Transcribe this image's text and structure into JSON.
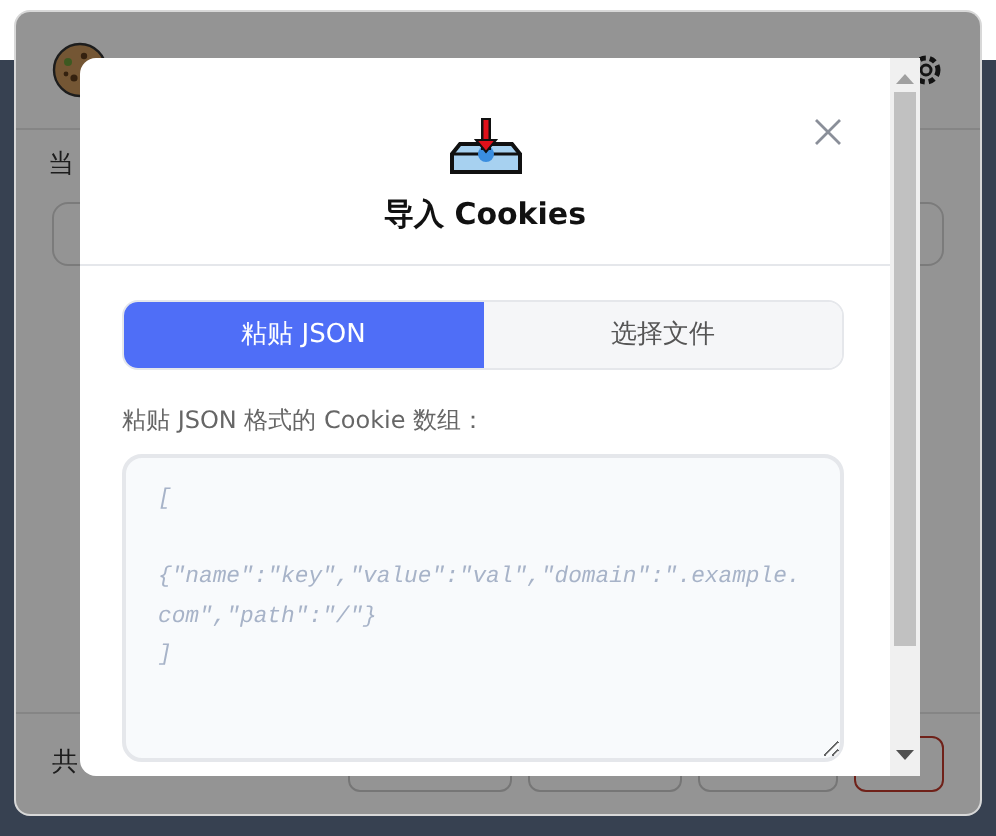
{
  "background": {
    "status_text": "当",
    "count_text": "共",
    "footer_buttons": [
      {
        "kind": "outline"
      },
      {
        "kind": "outline"
      },
      {
        "kind": "outline"
      },
      {
        "kind": "danger"
      }
    ]
  },
  "modal": {
    "title": "导入 Cookies",
    "tabs": [
      {
        "label": "粘贴 JSON",
        "selected": true
      },
      {
        "label": "选择文件",
        "selected": false
      }
    ],
    "field_label": "粘贴 JSON 格式的 Cookie 数组：",
    "textarea": {
      "placeholder": "[\n\n{\"name\":\"key\",\"value\":\"val\",\"domain\":\".example.com\",\"path\":\"/\"}\n]"
    }
  }
}
